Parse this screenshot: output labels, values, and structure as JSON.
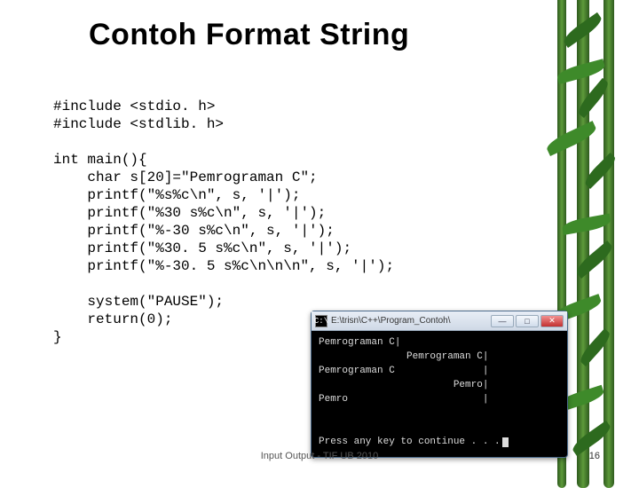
{
  "title": "Contoh Format String",
  "code": "#include <stdio. h>\n#include <stdlib. h>\n\nint main(){\n    char s[20]=\"Pemrograman C\";\n    printf(\"%s%c\\n\", s, '|');\n    printf(\"%30 s%c\\n\", s, '|');\n    printf(\"%-30 s%c\\n\", s, '|');\n    printf(\"%30. 5 s%c\\n\", s, '|');\n    printf(\"%-30. 5 s%c\\n\\n\\n\", s, '|');\n\n    system(\"PAUSE\");\n    return(0);\n}",
  "console": {
    "window_title": "E:\\trisn\\C++\\Program_Contoh\\",
    "iconChar": "C:\\",
    "lines": [
      "Pemrograman C|",
      "               Pemrograman C|",
      "Pemrograman C               |",
      "                       Pemro|",
      "Pemro                       |",
      "",
      "",
      "Press any key to continue . . ."
    ],
    "btnMin": "—",
    "btnMax": "□",
    "btnClose": "✕"
  },
  "footer": "Input Output - TIF UB 2010",
  "pageNumber": "16"
}
